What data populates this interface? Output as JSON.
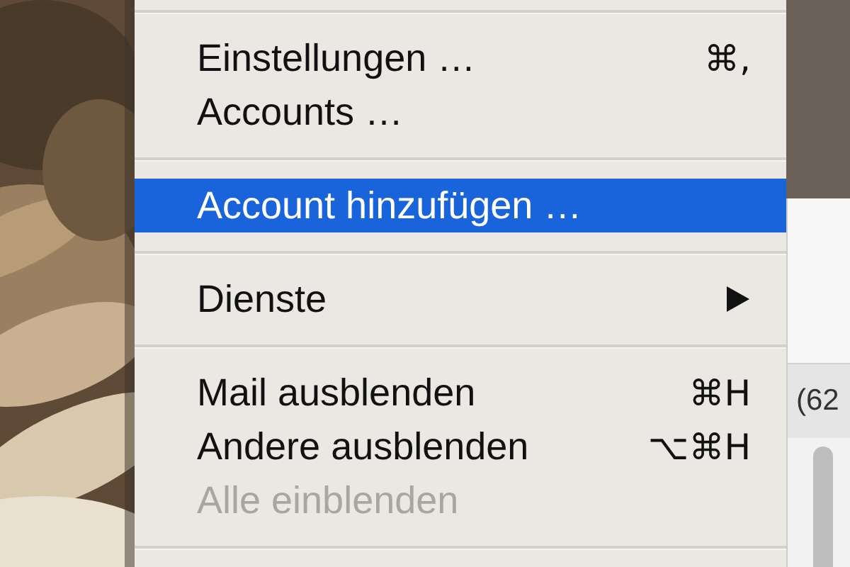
{
  "menu": {
    "sections": [
      {
        "items": [
          {
            "label": "Einstellungen …",
            "shortcut": "⌘,",
            "selected": false,
            "disabled": false,
            "has_submenu": false
          },
          {
            "label": "Accounts …",
            "selected": false,
            "disabled": false,
            "has_submenu": false
          }
        ]
      },
      {
        "items": [
          {
            "label": "Account hinzufügen …",
            "selected": true,
            "disabled": false,
            "has_submenu": false
          }
        ]
      },
      {
        "items": [
          {
            "label": "Dienste",
            "selected": false,
            "disabled": false,
            "has_submenu": true
          }
        ]
      },
      {
        "items": [
          {
            "label": "Mail ausblenden",
            "shortcut": "⌘H",
            "selected": false,
            "disabled": false,
            "has_submenu": false
          },
          {
            "label": "Andere ausblenden",
            "shortcut": "⌥⌘H",
            "selected": false,
            "disabled": false,
            "has_submenu": false
          },
          {
            "label": "Alle einblenden",
            "selected": false,
            "disabled": true,
            "has_submenu": false
          }
        ]
      }
    ]
  },
  "background_window": {
    "toolbar_text": "(62"
  }
}
